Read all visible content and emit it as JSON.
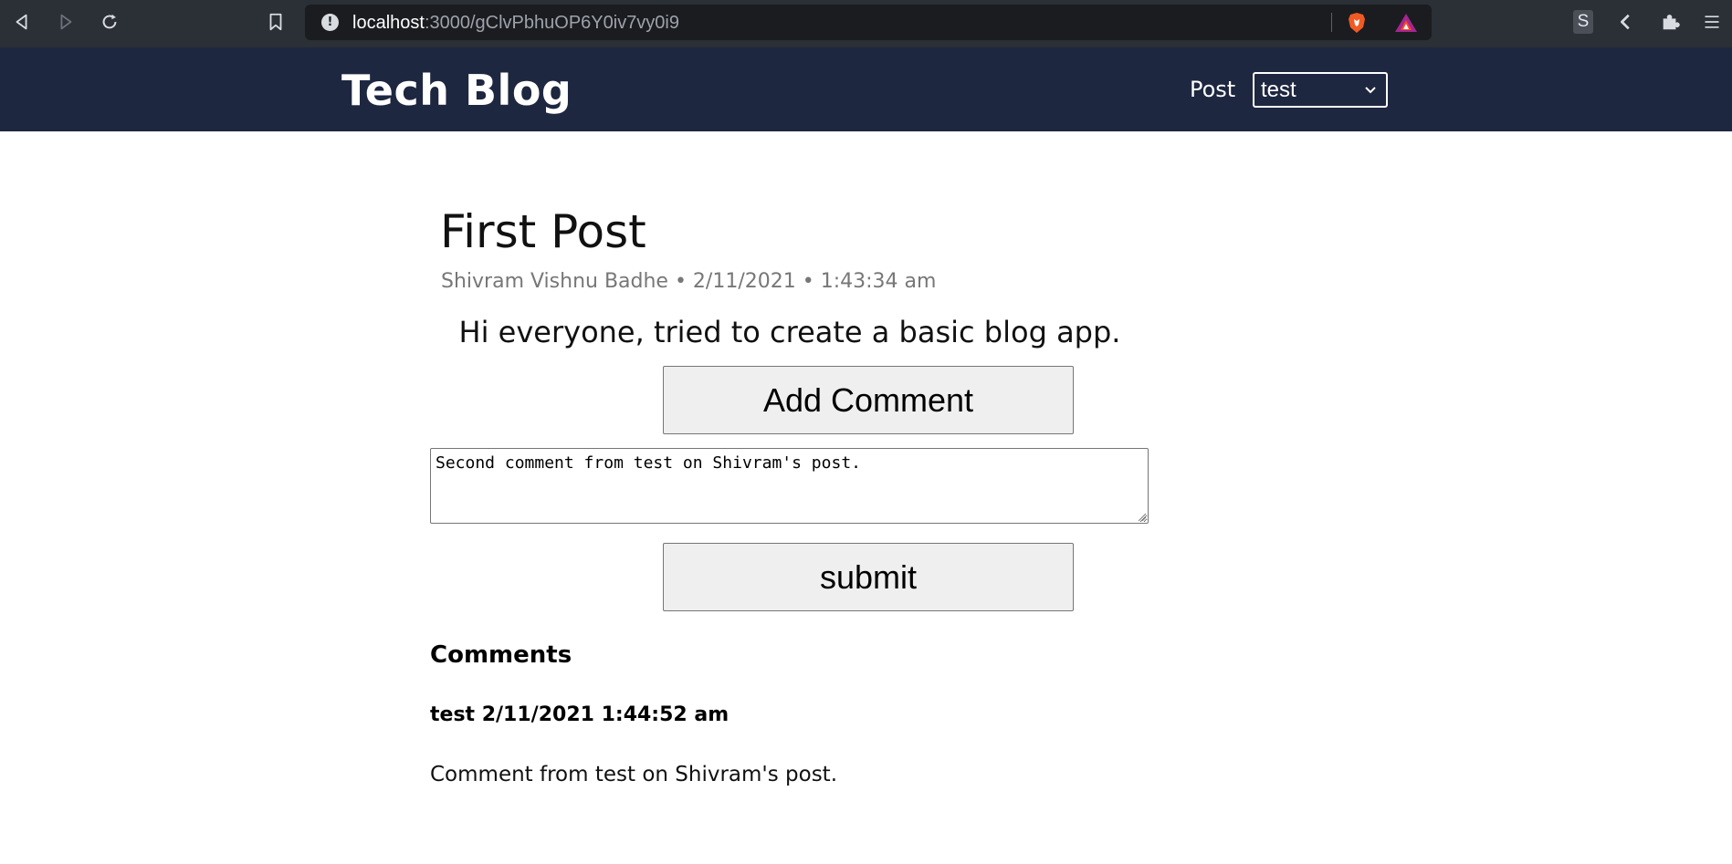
{
  "browser": {
    "url_host": "localhost",
    "url_path": ":3000/gClvPbhuOP6Y0iv7vy0i9",
    "extension_label": "S",
    "icons": [
      "back-icon",
      "forward-icon",
      "reload-icon",
      "bookmark-icon",
      "info-icon",
      "brave-shield-icon",
      "brave-rewards-icon",
      "extension-s-icon",
      "sidebar-collapse-icon",
      "puzzle-icon",
      "menu-icon"
    ]
  },
  "header": {
    "site_title": "Tech Blog",
    "post_label": "Post",
    "post_select_value": "test",
    "background": "#1e2740"
  },
  "post": {
    "title": "First Post",
    "meta": "Shivram Vishnu Badhe • 2/11/2021 • 1:43:34 am",
    "body": "Hi everyone, tried to create a basic blog app."
  },
  "comment_form": {
    "add_button_label": "Add Comment",
    "textarea_value": "Second comment from test on Shivram's post.",
    "submit_button_label": "submit"
  },
  "comments": {
    "heading": "Comments",
    "items": [
      {
        "header": "test 2/11/2021 1:44:52 am",
        "body": "Comment from test on Shivram's post."
      }
    ]
  }
}
